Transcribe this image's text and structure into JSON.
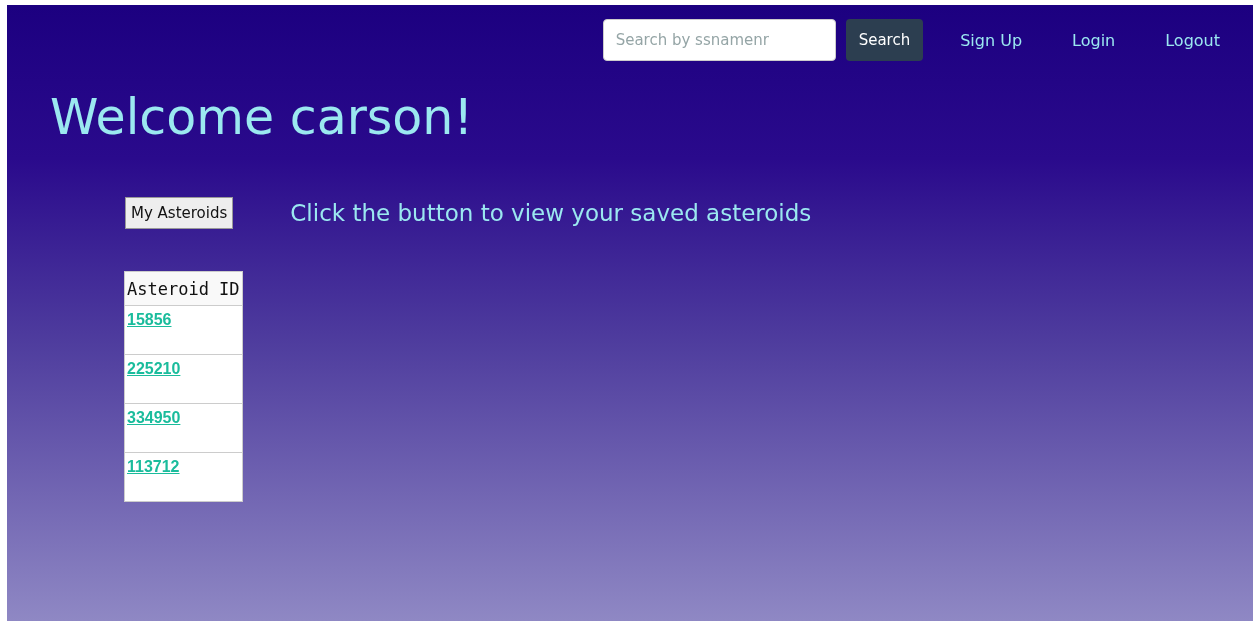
{
  "nav": {
    "search": {
      "placeholder": "Search by ssnamenr"
    },
    "search_button": "Search",
    "links": [
      "Sign Up",
      "Login",
      "Logout"
    ]
  },
  "heading": "Welcome carson!",
  "my_asteroids_button": "My Asteroids",
  "hint": "Click the button to view your saved asteroids",
  "table": {
    "columns": [
      "Asteroid ID"
    ],
    "rows": [
      "15856",
      "225210",
      "334950",
      "113712"
    ]
  }
}
